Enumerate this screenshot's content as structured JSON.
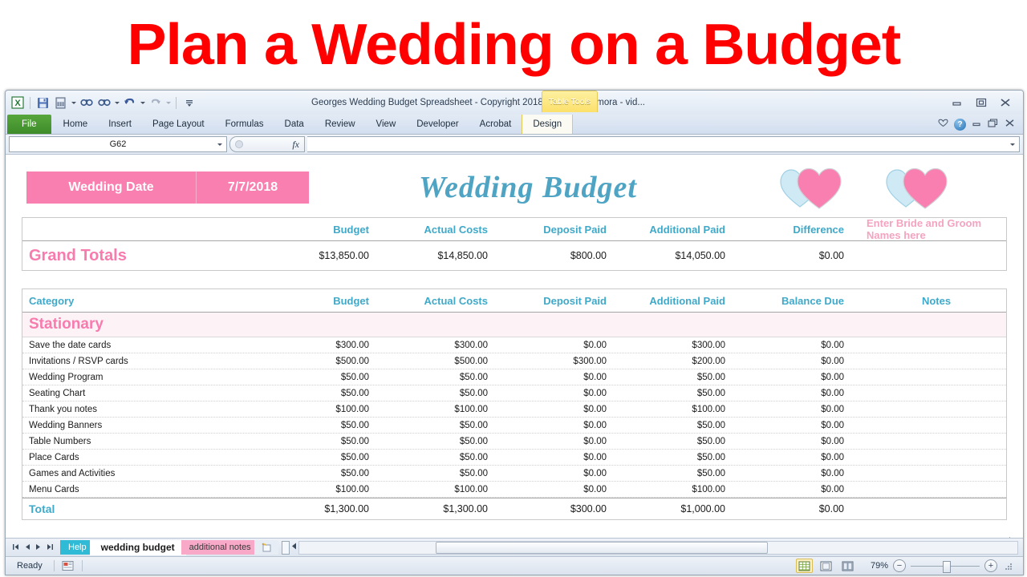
{
  "banner": {
    "title": "Plan a Wedding on a Budget",
    "color": "#FF0000"
  },
  "window": {
    "title": "Georges Wedding Budget Spreadsheet - Copyright 2018 George Alzamora - vid...",
    "contextual_tab": "Table Tools",
    "quick_access": [
      "excel-logo",
      "save-icon",
      "calculator-icon",
      "find-icon",
      "find-replace-icon",
      "undo-icon",
      "redo-icon",
      "customize-icon"
    ],
    "window_buttons": [
      "minimize",
      "restore",
      "close"
    ],
    "ribbon_buttons": [
      "ribbon-options",
      "help",
      "minimize-ribbon",
      "restore-ribbon",
      "close-window"
    ]
  },
  "ribbon": {
    "tabs": [
      "File",
      "Home",
      "Insert",
      "Page Layout",
      "Formulas",
      "Data",
      "Review",
      "View",
      "Developer",
      "Acrobat"
    ],
    "design_tab": "Design",
    "help_label": "?"
  },
  "formula_bar": {
    "name_box": "G62",
    "formula": "",
    "fx_label": "fx"
  },
  "sheet": {
    "wedding_date_label": "Wedding Date",
    "wedding_date_value": "7/7/2018",
    "sheet_title": "Wedding Budget",
    "accent_pink": "#F97FB0",
    "accent_teal": "#3FA9C9"
  },
  "totals_table": {
    "headers": [
      "",
      "Budget",
      "Actual Costs",
      "Deposit Paid",
      "Additional Paid",
      "Difference",
      "Enter Bride and Groom Names here"
    ],
    "grand_totals_label": "Grand Totals",
    "grand_totals": [
      "$13,850.00",
      "$14,850.00",
      "$800.00",
      "$14,050.00",
      "$0.00"
    ],
    "names_value": ""
  },
  "budget_table": {
    "headers": [
      "Category",
      "Budget",
      "Actual Costs",
      "Deposit Paid",
      "Additional Paid",
      "Balance Due",
      "Notes"
    ],
    "section": "Stationary",
    "rows": [
      {
        "category": "Save the date cards",
        "budget": "$300.00",
        "actual": "$300.00",
        "deposit": "$0.00",
        "additional": "$300.00",
        "balance": "$0.00",
        "notes": ""
      },
      {
        "category": "Invitations / RSVP cards",
        "budget": "$500.00",
        "actual": "$500.00",
        "deposit": "$300.00",
        "additional": "$200.00",
        "balance": "$0.00",
        "notes": ""
      },
      {
        "category": "Wedding Program",
        "budget": "$50.00",
        "actual": "$50.00",
        "deposit": "$0.00",
        "additional": "$50.00",
        "balance": "$0.00",
        "notes": ""
      },
      {
        "category": "Seating Chart",
        "budget": "$50.00",
        "actual": "$50.00",
        "deposit": "$0.00",
        "additional": "$50.00",
        "balance": "$0.00",
        "notes": ""
      },
      {
        "category": "Thank you notes",
        "budget": "$100.00",
        "actual": "$100.00",
        "deposit": "$0.00",
        "additional": "$100.00",
        "balance": "$0.00",
        "notes": ""
      },
      {
        "category": "Wedding Banners",
        "budget": "$50.00",
        "actual": "$50.00",
        "deposit": "$0.00",
        "additional": "$50.00",
        "balance": "$0.00",
        "notes": ""
      },
      {
        "category": "Table Numbers",
        "budget": "$50.00",
        "actual": "$50.00",
        "deposit": "$0.00",
        "additional": "$50.00",
        "balance": "$0.00",
        "notes": ""
      },
      {
        "category": "Place Cards",
        "budget": "$50.00",
        "actual": "$50.00",
        "deposit": "$0.00",
        "additional": "$50.00",
        "balance": "$0.00",
        "notes": ""
      },
      {
        "category": "Games and Activities",
        "budget": "$50.00",
        "actual": "$50.00",
        "deposit": "$0.00",
        "additional": "$50.00",
        "balance": "$0.00",
        "notes": ""
      },
      {
        "category": "Menu Cards",
        "budget": "$100.00",
        "actual": "$100.00",
        "deposit": "$0.00",
        "additional": "$100.00",
        "balance": "$0.00",
        "notes": ""
      }
    ],
    "total_label": "Total",
    "totals": [
      "$1,300.00",
      "$1,300.00",
      "$300.00",
      "$1,000.00",
      "$0.00"
    ]
  },
  "sheet_tabs": [
    {
      "label": "Help",
      "active": false
    },
    {
      "label": "wedding budget",
      "active": true
    },
    {
      "label": "additional notes",
      "active": false
    }
  ],
  "status_bar": {
    "status": "Ready",
    "zoom": "79%",
    "zoom_out": "−",
    "zoom_in": "+",
    "views": [
      "normal-view",
      "page-layout-view",
      "page-break-view"
    ]
  }
}
